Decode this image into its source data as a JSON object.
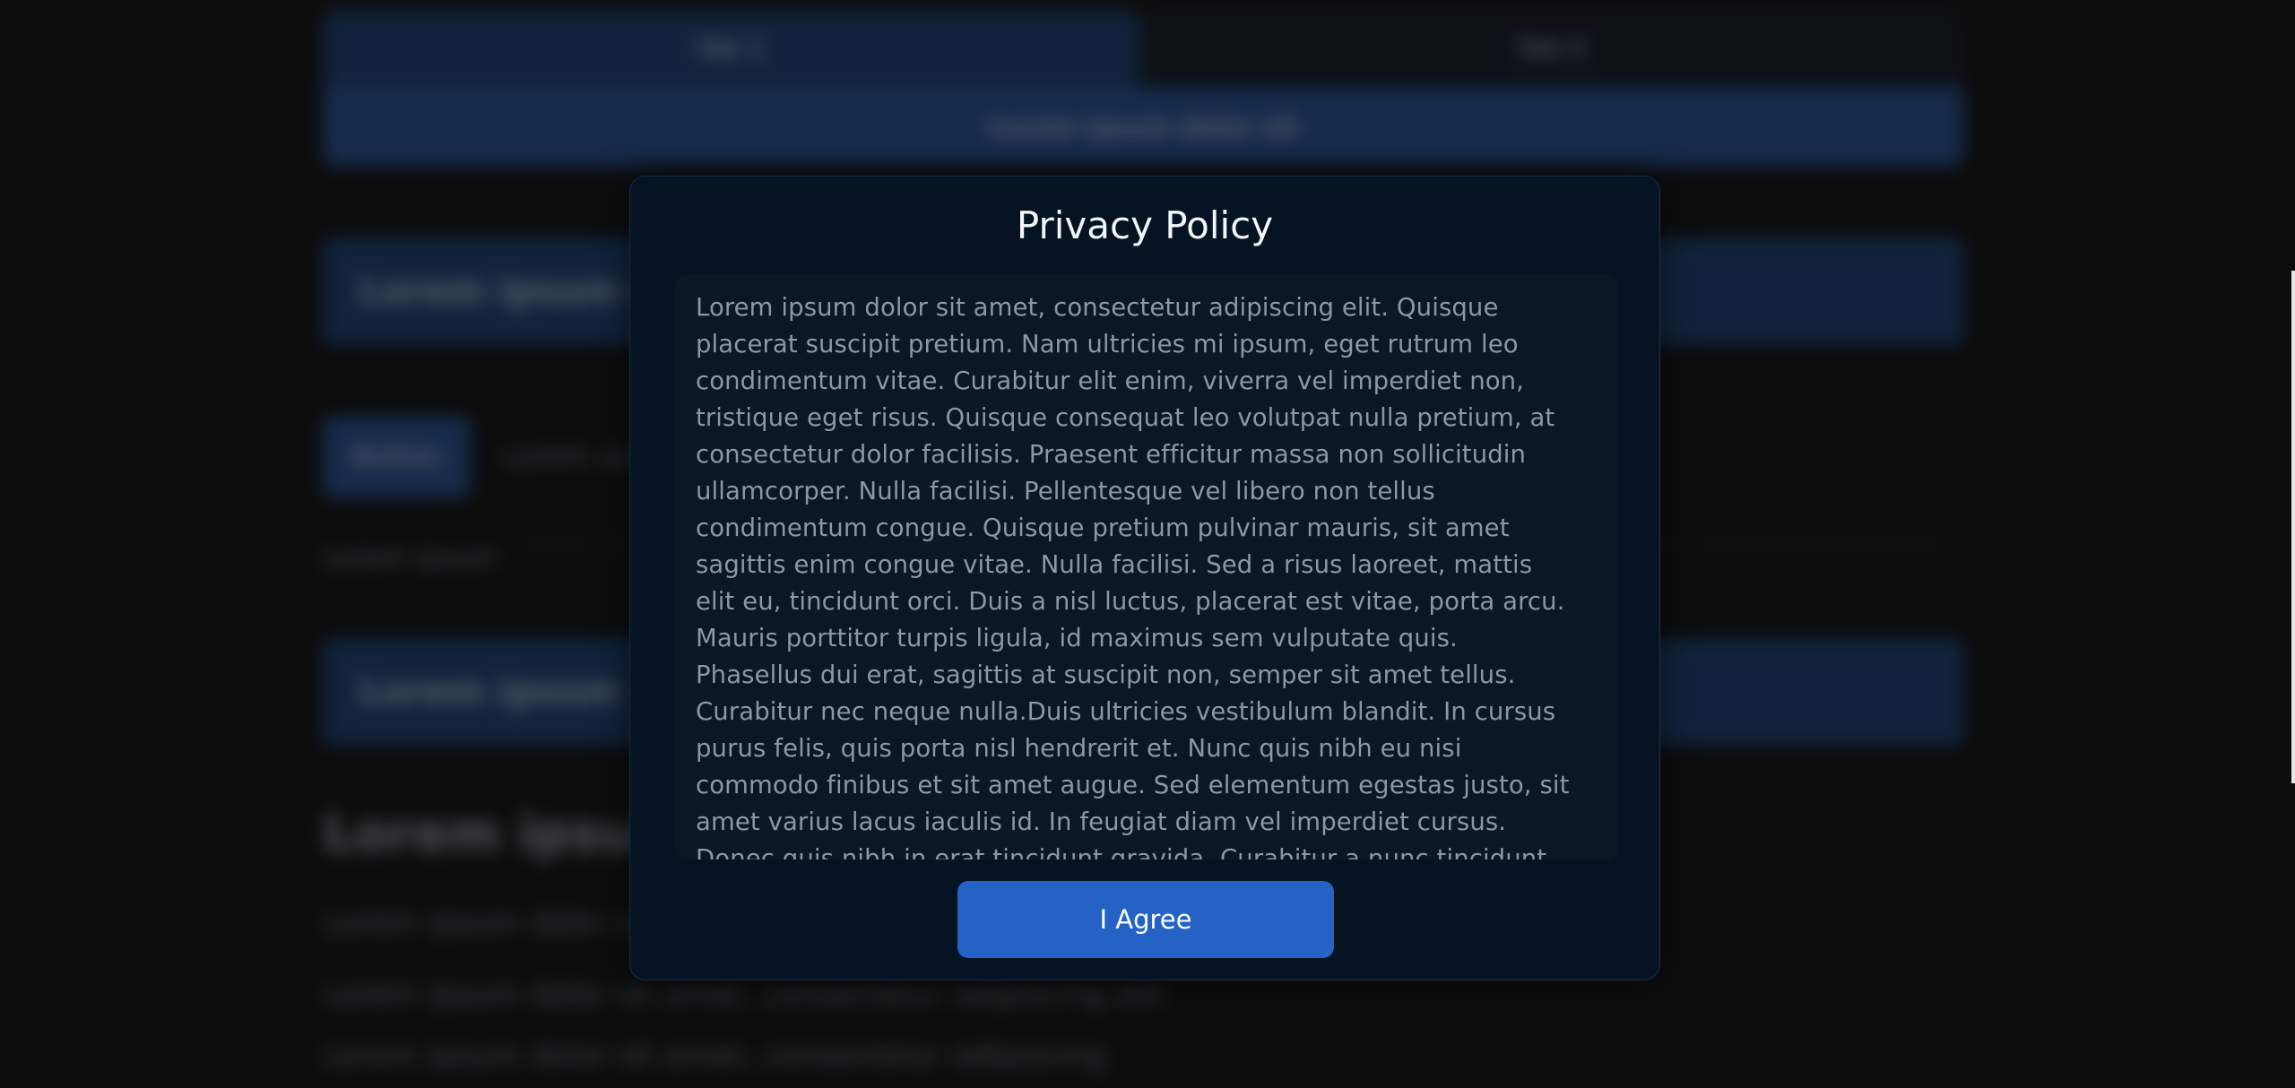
{
  "background_page": {
    "tabs": [
      "Tab 1",
      "Tab 2"
    ],
    "bar_label": "Lorem ipsum dolor sit",
    "banner_text": "Lorem ipsum dolor sit amet",
    "small_button_label": "Button",
    "inline_text": "Lorem ipsum",
    "field_label": "Lorem ipsum",
    "banner2_text": "Lorem ipsum",
    "heading": "Lorem ipsum",
    "lines": [
      "Lorem ipsum dolor sit amet",
      "Lorem ipsum dolor sit amet, consectetur adipiscing elit",
      "Lorem ipsum dolor sit amet, consectetur adipiscing"
    ]
  },
  "modal": {
    "title": "Privacy Policy",
    "policy_text": "Lorem ipsum dolor sit amet, consectetur adipiscing elit. Quisque placerat suscipit pretium. Nam ultricies mi ipsum, eget rutrum leo condimentum vitae. Curabitur elit enim, viverra vel imperdiet non, tristique eget risus. Quisque consequat leo volutpat nulla pretium, at consectetur dolor facilisis. Praesent efficitur massa non sollicitudin ullamcorper. Nulla facilisi. Pellentesque vel libero non tellus condimentum congue. Quisque pretium pulvinar mauris, sit amet sagittis enim congue vitae. Nulla facilisi. Sed a risus laoreet, mattis elit eu, tincidunt orci. Duis a nisl luctus, placerat est vitae, porta arcu. Mauris porttitor turpis ligula, id maximus sem vulputate quis. Phasellus dui erat, sagittis at suscipit non, semper sit amet tellus. Curabitur nec neque nulla.Duis ultricies vestibulum blandit. In cursus purus felis, quis porta nisl hendrerit et. Nunc quis nibh eu nisi commodo finibus et sit amet augue. Sed elementum egestas justo, sit amet varius lacus iaculis id. In feugiat diam vel imperdiet cursus. Donec quis nibh in erat tincidunt gravida. Curabitur a nunc tincidunt nisl pulvinar",
    "agree_button": "I Agree"
  },
  "colors": {
    "page_background": "#121212",
    "modal_background": "#061322",
    "text_box_background": "#0b1725",
    "button_blue": "#2463c5",
    "title_text": "#f2f5f9",
    "body_text": "#8a97a6"
  }
}
